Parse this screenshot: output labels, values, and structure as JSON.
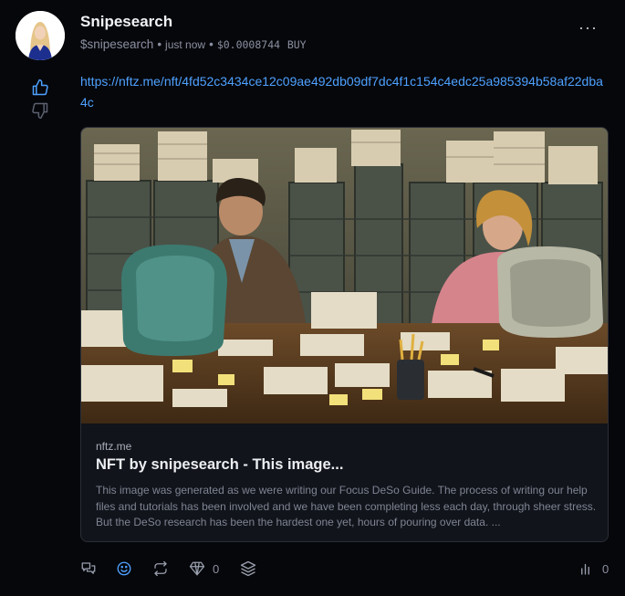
{
  "post": {
    "author_name": "Snipesearch",
    "username": "$snipesearch",
    "timestamp": "just now",
    "price": "$0.0008744",
    "buy_label": "BUY",
    "more_label": "···",
    "link_text": "https://nftz.me/nft/4fd52c3434ce12c09ae492db09df7dc4f1c154c4edc25a985394b58af22dba4c"
  },
  "preview": {
    "domain": "nftz.me",
    "title": "NFT by snipesearch - This image...",
    "description": "This image was generated as we were writing our Focus DeSo Guide. The process of writing our help files and tutorials has been involved and we have been completing less each day, through sheer stress. But the DeSo research has been the hardest one yet, hours of pouring over data. ..."
  },
  "actions": {
    "diamond_count": "0",
    "views_count": "0"
  },
  "icons": [
    "thumbs-up-icon",
    "thumbs-down-icon",
    "comment-icon",
    "emoji-icon",
    "repost-icon",
    "diamond-icon",
    "layers-icon",
    "bar-chart-icon",
    "more-icon"
  ],
  "colors": {
    "background": "#06070b",
    "link": "#4ea1ff",
    "card_background": "#11141b",
    "muted_text": "#8b90a0"
  }
}
